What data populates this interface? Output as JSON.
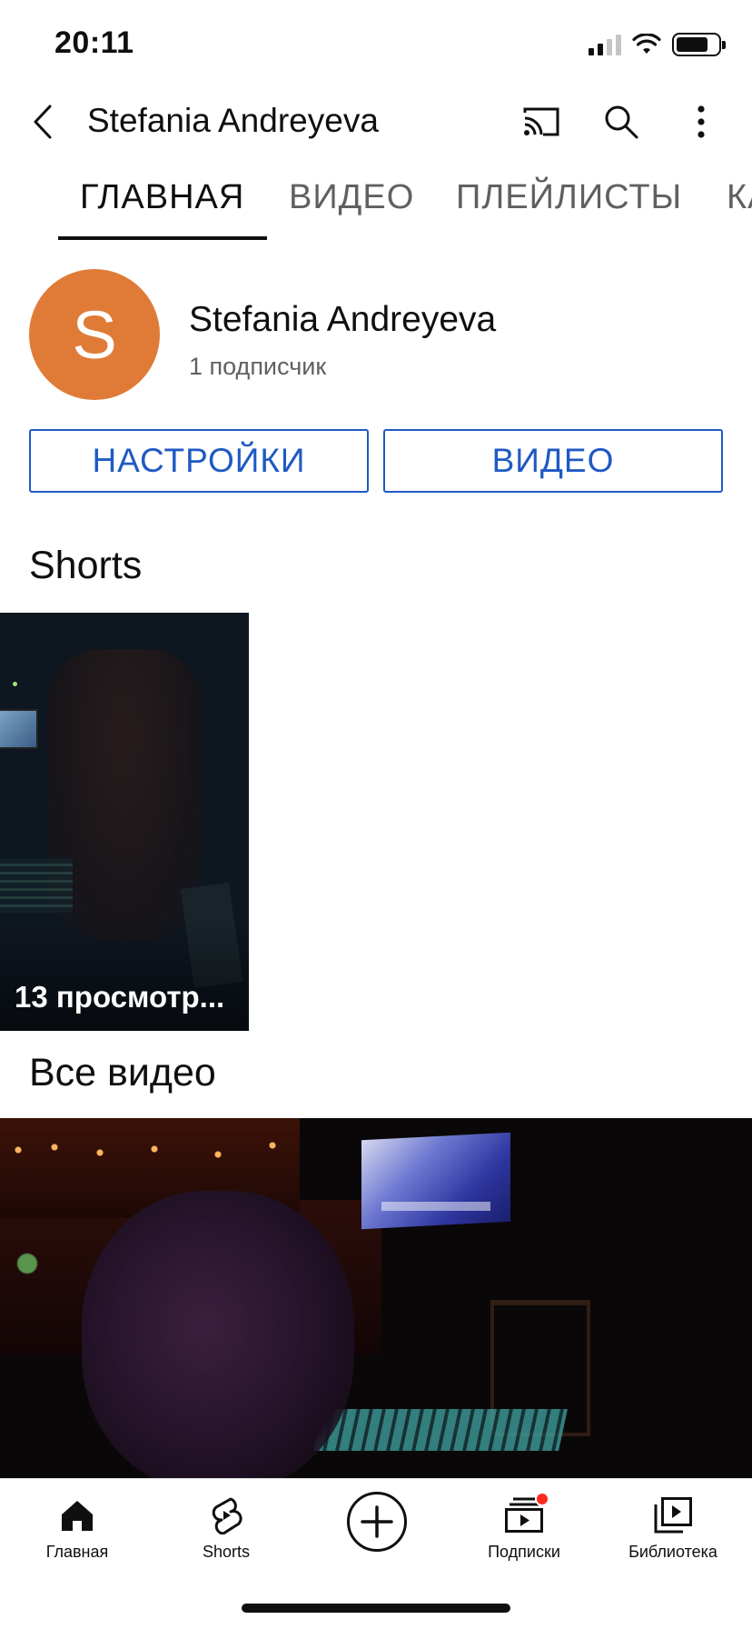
{
  "status_bar": {
    "time": "20:11",
    "icons": [
      "signal-icon",
      "wifi-icon",
      "battery-icon"
    ]
  },
  "app_bar": {
    "title": "Stefania Andreyeva",
    "icons": [
      "back-arrow-icon",
      "cast-icon",
      "search-icon",
      "more-vert-icon"
    ]
  },
  "tabs": [
    {
      "label": "ГЛАВНАЯ",
      "active": true
    },
    {
      "label": "ВИДЕО",
      "active": false
    },
    {
      "label": "ПЛЕЙЛИСТЫ",
      "active": false
    },
    {
      "label": "КА",
      "active": false
    }
  ],
  "channel": {
    "avatar_letter": "S",
    "avatar_color": "#e07b37",
    "name": "Stefania Andreyeva",
    "subscribers": "1 подписчик"
  },
  "buttons": {
    "settings": "НАСТРОЙКИ",
    "video": "ВИДЕО",
    "accent_color": "#1f59c4"
  },
  "shorts": {
    "heading": "Shorts",
    "items": [
      {
        "views": "13 просмотр..."
      }
    ]
  },
  "all_videos": {
    "heading": "Все видео"
  },
  "bottom_nav": {
    "items": [
      {
        "label": "Главная",
        "icon": "home-icon",
        "active": true
      },
      {
        "label": "Shorts",
        "icon": "shorts-icon",
        "active": false
      },
      {
        "label": "",
        "icon": "create-plus-icon",
        "active": false
      },
      {
        "label": "Подписки",
        "icon": "subscriptions-icon",
        "active": false,
        "badge": true
      },
      {
        "label": "Библиотека",
        "icon": "library-icon",
        "active": false
      }
    ],
    "badge_color": "#ff2a1f"
  }
}
